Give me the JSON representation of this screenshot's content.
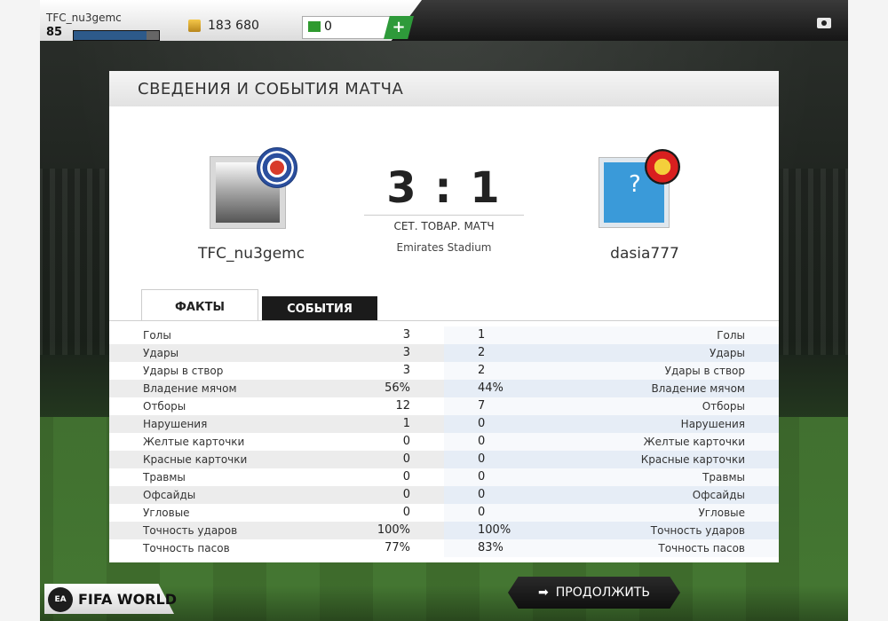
{
  "topbar": {
    "player_name": "TFC_nu3gemc",
    "level": "85",
    "xp_fraction": 0.85,
    "coins": "183 680",
    "points": "0",
    "plus_label": "+"
  },
  "panel": {
    "title": "СВЕДЕНИЯ И СОБЫТИЯ МАТЧА",
    "home_name": "TFC_nu3gemc",
    "away_name": "dasia777",
    "score": "3 : 1",
    "match_type": "СЕТ. ТОВАР. МАТЧ",
    "stadium": "Emirates Stadium",
    "avatar_placeholder": "?"
  },
  "tabs": {
    "facts": "ФАКТЫ",
    "events": "СОБЫТИЯ"
  },
  "stats": [
    {
      "label": "Голы",
      "home": "3",
      "away": "1"
    },
    {
      "label": "Удары",
      "home": "3",
      "away": "2"
    },
    {
      "label": "Удары в створ",
      "home": "3",
      "away": "2"
    },
    {
      "label": "Владение мячом",
      "home": "56%",
      "away": "44%"
    },
    {
      "label": "Отборы",
      "home": "12",
      "away": "7"
    },
    {
      "label": "Нарушения",
      "home": "1",
      "away": "0"
    },
    {
      "label": "Желтые карточки",
      "home": "0",
      "away": "0"
    },
    {
      "label": "Красные карточки",
      "home": "0",
      "away": "0"
    },
    {
      "label": "Травмы",
      "home": "0",
      "away": "0"
    },
    {
      "label": "Офсайды",
      "home": "0",
      "away": "0"
    },
    {
      "label": "Угловые",
      "home": "0",
      "away": "0"
    },
    {
      "label": "Точность ударов",
      "home": "100%",
      "away": "100%"
    },
    {
      "label": "Точность пасов",
      "home": "77%",
      "away": "83%"
    }
  ],
  "footer": {
    "ea_badge": "EA",
    "logo_text": "FIFA WORLD",
    "continue_label": "ПРОДОЛЖИТЬ",
    "continue_icon": "arrow-right-icon"
  },
  "colors": {
    "accent_green": "#2e9a3a",
    "xp_blue": "#2d5a8a",
    "dark_button": "#1b1b1b"
  }
}
